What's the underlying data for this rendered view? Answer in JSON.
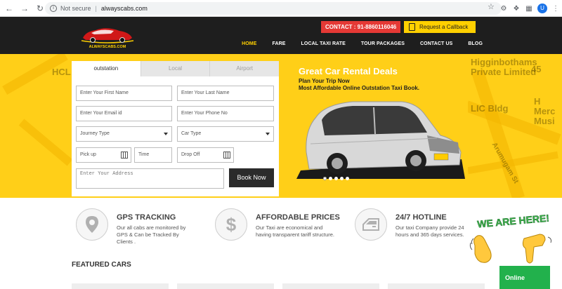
{
  "browser": {
    "security_label": "Not secure",
    "separator": "|",
    "url": "alwayscabs.com",
    "profile_initial": "U"
  },
  "header": {
    "logo_text": "ALWAYSCABS.COM",
    "contact_text": "CONTACT : 91-8860116046",
    "callback_label": "Request a Callback",
    "nav": [
      "HOME",
      "FARE",
      "LOCAL TAXI RATE",
      "TOUR PACKAGES",
      "CONTACT US",
      "BLOG"
    ],
    "active_nav": "HOME"
  },
  "map_labels": [
    "HCL",
    "Higginbothams",
    "Private Limited",
    "LIC Bldg",
    "H",
    "Merc",
    "Musi",
    "Arumugam St",
    "45"
  ],
  "booking": {
    "tabs": [
      "outstation",
      "Local",
      "Airport"
    ],
    "active_tab": "outstation",
    "first_name_placeholder": "Enter Your First Name",
    "last_name_placeholder": "Enter Your Last Name",
    "email_placeholder": "Enter Your Email id",
    "phone_placeholder": "Enter Your Phone No",
    "journey_type": "Journey Type",
    "car_type": "Car Type",
    "pickup_placeholder": "Pick up",
    "time_placeholder": "Time",
    "dropoff_placeholder": "Drop Off",
    "address_placeholder": "Enter Your Address",
    "submit_label": "Book Now"
  },
  "slider": {
    "title": "Great Car Rental Deals",
    "line1": "Plan Your Trip Now",
    "line2": "Most Affordable Online Outstation Taxi Book.",
    "slide_count": 5,
    "active_slide": 1
  },
  "features": [
    {
      "title": "GPS TRACKING",
      "text": "Our all cabs are monitored by GPS & Can be Tracked By Clients .",
      "icon": "map-pin-icon"
    },
    {
      "title": "AFFORDABLE PRICES",
      "text": "Our Taxi are economical and having transparent tariff structure.",
      "icon": "dollar-icon"
    },
    {
      "title": "24/7 HOTLINE",
      "text": "Our taxi Company provide 24 hours and 365 days services.",
      "icon": "car-door-icon"
    }
  ],
  "featured_heading": "FEATURED CARS",
  "chat": {
    "banner": "WE ARE HERE!",
    "status": "Online"
  },
  "colors": {
    "brand_yellow": "#ffcf18",
    "header_dark": "#1e1e1e",
    "contact_red": "#e53935",
    "online_green": "#22b14c"
  }
}
